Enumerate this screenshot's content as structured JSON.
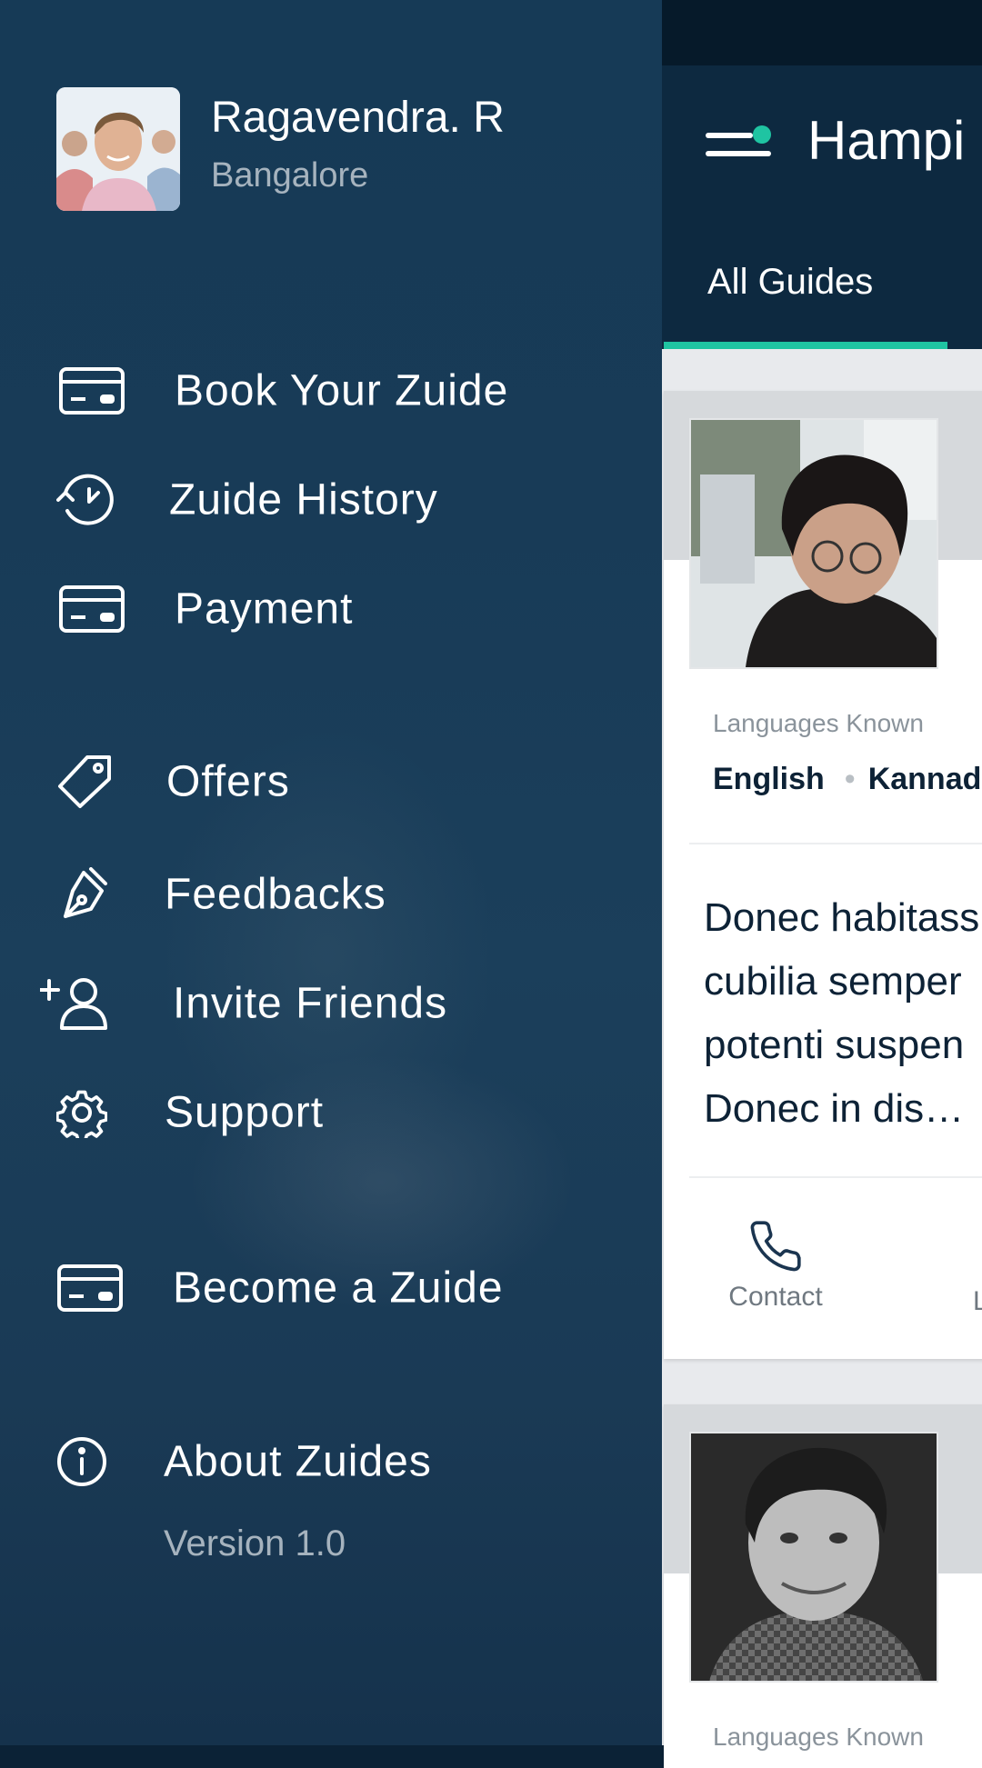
{
  "app": {
    "title": "Hampi",
    "tab_active": "All Guides",
    "accent_color": "#1fc4a2",
    "header_color": "#0d2940"
  },
  "drawer": {
    "user": {
      "name": "Ragavendra. R",
      "city": "Bangalore"
    },
    "items": [
      {
        "label": "Book Your Zuide",
        "icon": "card-icon"
      },
      {
        "label": "Zuide History",
        "icon": "history-icon"
      },
      {
        "label": "Payment",
        "icon": "card-icon"
      },
      {
        "label": "Offers",
        "icon": "tag-icon"
      },
      {
        "label": "Feedbacks",
        "icon": "pen-icon"
      },
      {
        "label": "Invite Friends",
        "icon": "add-user-icon"
      },
      {
        "label": "Support",
        "icon": "gear-icon"
      },
      {
        "label": "Become a Zuide",
        "icon": "card-icon"
      },
      {
        "label": "About Zuides",
        "icon": "info-icon"
      }
    ],
    "version": "Version 1.0"
  },
  "guides": [
    {
      "languages_label": "Languages Known",
      "languages": [
        "English",
        "Kannada"
      ],
      "description": [
        "Donec habitass",
        "cubilia semper",
        "potenti suspen",
        "Donec  in dis…"
      ],
      "contact_label": "Contact",
      "second_action_initial": "L"
    },
    {
      "languages_label": "Languages Known"
    }
  ]
}
